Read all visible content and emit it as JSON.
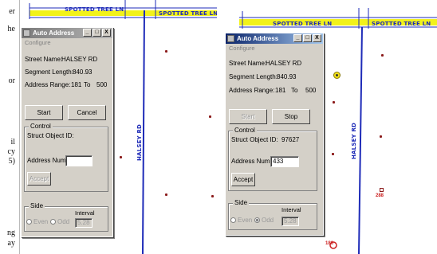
{
  "left_text": [
    "er",
    "he",
    "or",
    "il",
    "cy",
    "5)",
    "ng",
    "ay"
  ],
  "map1": {
    "horizontal_street_labels": [
      "SPOTTED TREE LN",
      "SPOTTED TREE LN"
    ],
    "vertical_street_label": "HALSEY RD"
  },
  "map2": {
    "horizontal_street_labels": [
      "SPOTTED TREE LN",
      "SPOTTED TREE LN"
    ],
    "vertical_street_label": "HALSEY RD",
    "marker_labels": [
      "288",
      "186"
    ]
  },
  "dialog1": {
    "title": "Auto Address",
    "min_label": "_",
    "max_label": "□",
    "close_label": "X",
    "menu": "Configure",
    "street_name_label": "Street Name:",
    "street_name_value": "HALSEY RD",
    "segment_length_label": "Segment Length:",
    "segment_length_value": "840.93",
    "address_range_label": "Address Range:",
    "address_range_from": "181",
    "address_range_to_label": "To",
    "address_range_to": "500",
    "start_label": "Start",
    "second_button_label": "Cancel",
    "control_group_label": "Control",
    "struct_object_label": "Struct Object ID:",
    "struct_object_value": "",
    "address_number_label": "Address Number:",
    "address_number_value": "",
    "accept_label": "Accept",
    "side_group_label": "Side",
    "even_label": "Even",
    "odd_label": "Odd",
    "interval_label": "Interval",
    "interval_value": "5.28"
  },
  "dialog2": {
    "title": "Auto Address",
    "min_label": "_",
    "max_label": "□",
    "close_label": "X",
    "menu": "Configure",
    "street_name_label": "Street Name:",
    "street_name_value": "HALSEY RD",
    "segment_length_label": "Segment Length:",
    "segment_length_value": "840.93",
    "address_range_label": "Address Range:",
    "address_range_from": "181",
    "address_range_to_label": "To",
    "address_range_to": "500",
    "start_label": "Start",
    "second_button_label": "Stop",
    "control_group_label": "Control",
    "struct_object_label": "Struct Object ID:",
    "struct_object_value": "97627",
    "address_number_label": "Address Number:",
    "address_number_value": "433",
    "accept_label": "Accept",
    "side_group_label": "Side",
    "even_label": "Even",
    "odd_label": "Odd",
    "interval_label": "Interval",
    "interval_value": "5.28"
  },
  "colors": {
    "road_blue": "#1e2bb8",
    "road_yellow": "#f2f21a",
    "point_red": "#8b1a1a"
  }
}
